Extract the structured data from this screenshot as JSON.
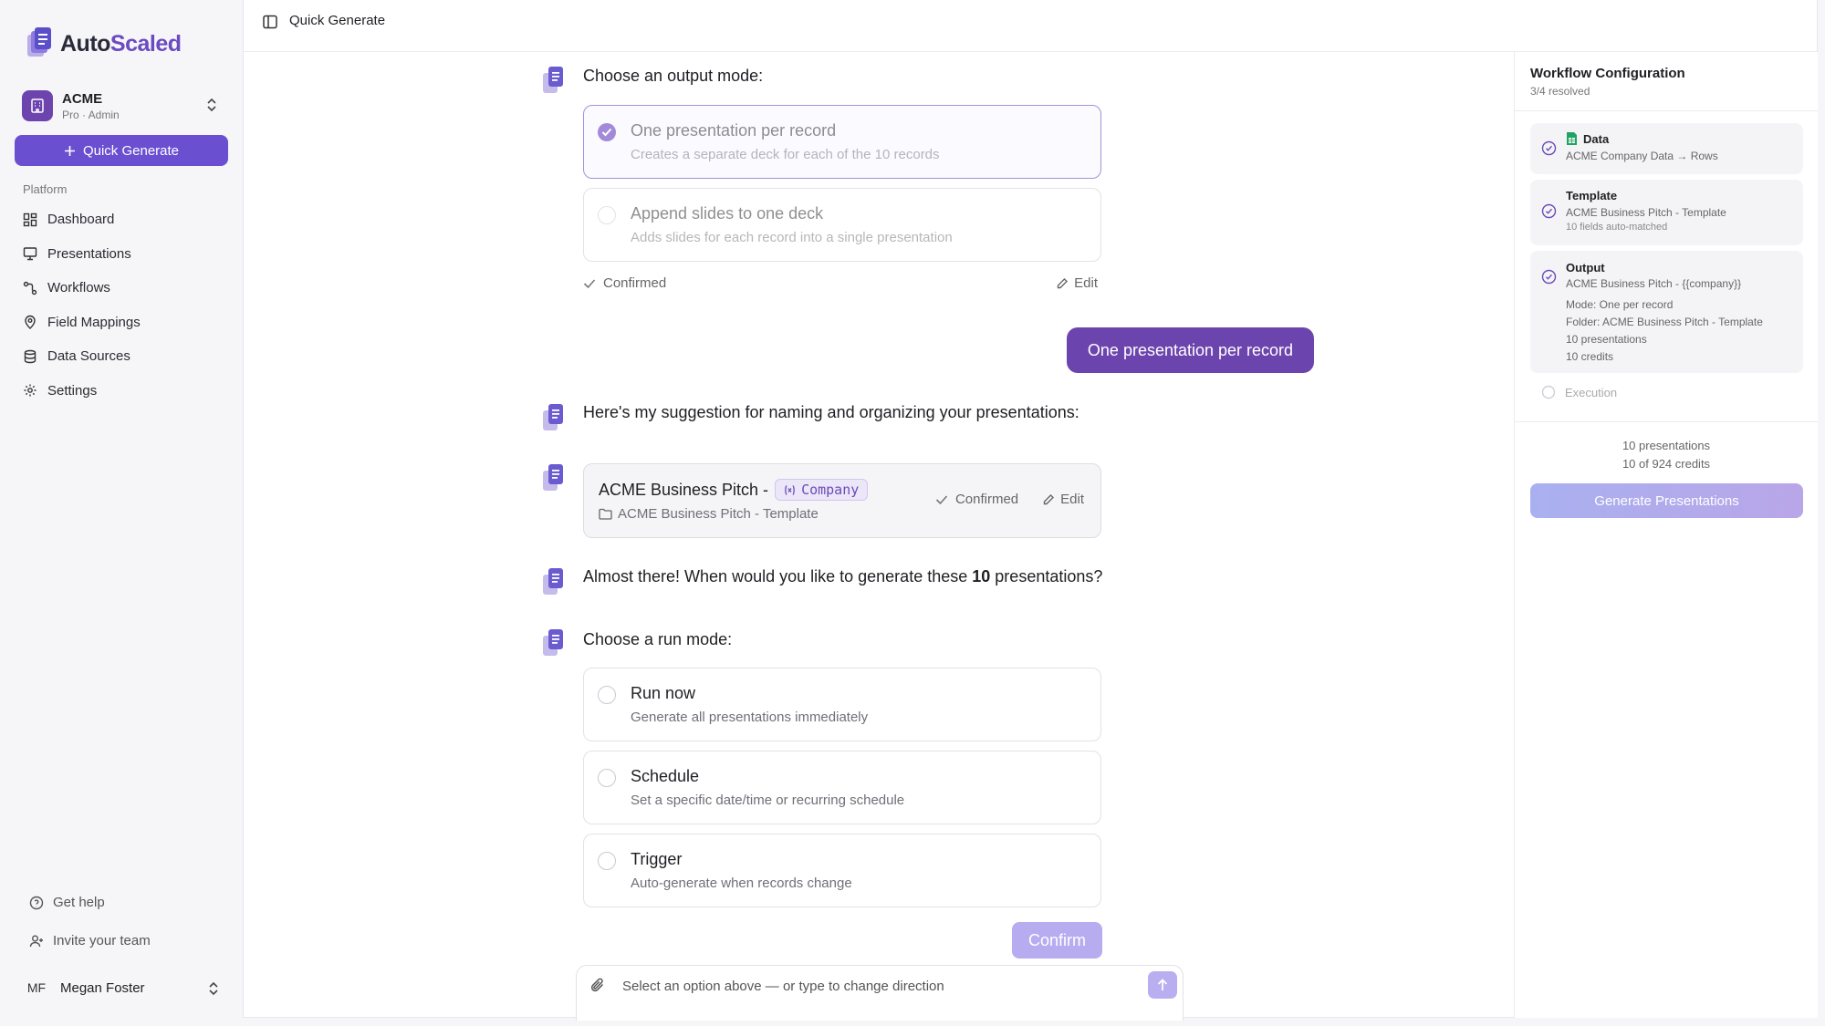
{
  "app": {
    "logo_prefix": "Auto",
    "logo_suffix": "Scaled"
  },
  "org": {
    "name": "ACME",
    "plan": "Pro · Admin"
  },
  "sidebar": {
    "quick_generate": "Quick Generate",
    "section_label": "Platform",
    "items": [
      {
        "label": "Dashboard",
        "icon": "dashboard-icon"
      },
      {
        "label": "Presentations",
        "icon": "presentation-icon"
      },
      {
        "label": "Workflows",
        "icon": "workflow-icon"
      },
      {
        "label": "Field Mappings",
        "icon": "map-pin-icon"
      },
      {
        "label": "Data Sources",
        "icon": "database-icon"
      },
      {
        "label": "Settings",
        "icon": "gear-icon"
      }
    ],
    "get_help": "Get help",
    "invite": "Invite your team",
    "user_initials": "MF",
    "user_name": "Megan Foster"
  },
  "header": {
    "title": "Quick Generate"
  },
  "chat": {
    "output_prompt": "Choose an output mode:",
    "output_options": [
      {
        "title": "One presentation per record",
        "desc": "Creates a separate deck for each of the 10 records",
        "selected": true
      },
      {
        "title": "Append slides to one deck",
        "desc": "Adds slides for each record into a single presentation",
        "selected": false
      }
    ],
    "confirmed_label": "Confirmed",
    "edit_label": "Edit",
    "user_reply": "One presentation per record",
    "naming_prompt": "Here's my suggestion for naming and organizing your presentations:",
    "naming": {
      "prefix": "ACME Business Pitch -",
      "variable": "Company",
      "folder": "ACME Business Pitch - Template",
      "confirmed": "Confirmed",
      "edit": "Edit"
    },
    "schedule_prompt_before": "Almost there! When would you like to generate these",
    "schedule_count": "10",
    "schedule_prompt_after": "presentations?",
    "run_prompt": "Choose a run mode:",
    "run_options": [
      {
        "title": "Run now",
        "desc": "Generate all presentations immediately"
      },
      {
        "title": "Schedule",
        "desc": "Set a specific date/time or recurring schedule"
      },
      {
        "title": "Trigger",
        "desc": "Auto-generate when records change"
      }
    ],
    "confirm_button": "Confirm",
    "input_placeholder": "Select an option above — or type to change direction"
  },
  "workflow": {
    "title": "Workflow Configuration",
    "resolved": "3/4 resolved",
    "data": {
      "label": "Data",
      "line1": "ACME Company Data → Rows"
    },
    "template": {
      "label": "Template",
      "line1": "ACME Business Pitch - Template",
      "line2": "10 fields auto-matched"
    },
    "output": {
      "label": "Output",
      "line1": "ACME Business Pitch - {{company}}",
      "line2": "Mode: One per record",
      "line3": "Folder: ACME Business Pitch - Template",
      "line4": "10 presentations",
      "line5": "10 credits"
    },
    "execution": "Execution",
    "stat_presentations": "10 presentations",
    "stat_credits": "10 of 924 credits",
    "generate_button": "Generate Presentations"
  },
  "colors": {
    "accent": "#6c44ad",
    "button": "#6a4fd1",
    "selected_border": "#a691d8"
  }
}
